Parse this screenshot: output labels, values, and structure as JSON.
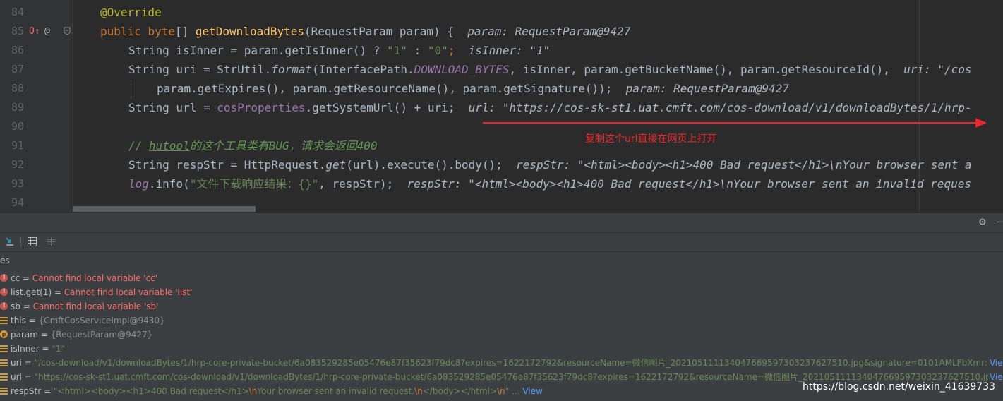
{
  "editor": {
    "line_numbers": [
      "84",
      "85",
      "86",
      "87",
      "88",
      "89",
      "90",
      "91",
      "92",
      "93",
      "94"
    ],
    "gutter_marks": {
      "override": "O↑",
      "at": "@"
    },
    "line84": {
      "annotation": "@Override"
    },
    "line85": {
      "kw_public": "public ",
      "kw_byte": "byte",
      "brackets": "[] ",
      "method": "getDownloadBytes",
      "params": "(RequestParam param) {",
      "hint": "param: RequestParam@9427"
    },
    "line86": {
      "decl": "String isInner = param.getIsInner() ? ",
      "s1": "\"1\"",
      "colon": " : ",
      "s2": "\"0\"",
      "semi": ";",
      "hint": "isInner: \"1\""
    },
    "line87": {
      "decl": "String uri = StrUtil.",
      "format": "format",
      "open": "(InterfacePath.",
      "const": "DOWNLOAD_BYTES",
      "rest": ", isInner, param.getBucketName(), param.getResourceId(),",
      "hint": "uri: \"/cos"
    },
    "line88": {
      "code": "param.getExpires(), param.getResourceName(), param.getSignature());",
      "hint": "param: RequestParam@9427"
    },
    "line89": {
      "decl": "String url = ",
      "field": "cosProperties",
      "rest": ".getSystemUrl() + uri;",
      "hint": "url: \"https://cos-sk-st1.uat.cmft.com/cos-download/v1/downloadBytes/1/hrp-"
    },
    "line91": {
      "slashes": "// ",
      "word": "hutool",
      "rest": "的这个工具类有BUG，请求会返回400"
    },
    "line92": {
      "decl": "String respStr = HttpRequest.",
      "get": "get",
      "rest": "(url).execute().body();",
      "hint": "respStr: \"<html><body><h1>400 Bad request</h1>\\nYour browser sent a"
    },
    "line93": {
      "log": "log",
      "info": ".info(",
      "s": "\"文件下载响应结果：{}\"",
      "rest": ", respStr);",
      "hint": "respStr: \"<html><body><h1>400 Bad request</h1>\\nYour browser sent an invalid reques"
    }
  },
  "annotation_text": "复制这个url直接在网页上打开",
  "panel": {
    "icons": {
      "gear": "gear-icon",
      "minimize": "minimize-icon",
      "table": "table-view-icon",
      "restore": "restore-layout-icon",
      "step": "step-into-icon"
    },
    "tab_label": "es",
    "variables": [
      {
        "icon": "error",
        "name": "cc",
        "eq": " = ",
        "value": "Cannot find local variable 'cc'"
      },
      {
        "icon": "error",
        "name": "list.get(1)",
        "eq": " = ",
        "value": "Cannot find local variable 'list'"
      },
      {
        "icon": "error",
        "name": "sb",
        "eq": " = ",
        "value": "Cannot find local variable 'sb'"
      },
      {
        "icon": "field",
        "name": "this",
        "eq": " = ",
        "value": "{CmftCosServiceImpl@9430}"
      },
      {
        "icon": "param",
        "name": "param",
        "eq": " = ",
        "value": "{RequestParam@9427}"
      },
      {
        "icon": "field",
        "name": "isInner",
        "eq": " = ",
        "value": "\"1\""
      },
      {
        "icon": "field",
        "name": "uri",
        "eq": " = ",
        "value": "\"/cos-download/v1/downloadBytes/1/hrp-core-private-bucket/6a083529285e05476e87f35623f79dc8?expires=1622172792&resourceName=微信图片_20210511113404766959730323762751­0.jpg&signature=0101AMLFbXmr:MDlFRTc...",
        "link": "Vie"
      },
      {
        "icon": "field",
        "name": "url",
        "eq": " = ",
        "value": "\"https://cos-sk-st1.uat.cmft.com/cos-download/v1/downloadBytes/1/hrp-core-private-bucket/6a083529285e05476e87f35623f79dc8?expires=1622172792&resourceName=微信图片_20210511113404766959730323762751­0.jpg&signa...",
        "link": "Vie"
      },
      {
        "icon": "field",
        "name": "respStr",
        "eq": " = ",
        "value_pre": "\"<html><body><h1>400 Bad request</h1>",
        "esc1": "\\n",
        "value_mid": "Your browser sent an invalid request.",
        "esc2": "\\n",
        "value_post": "</body></html>",
        "esc3": "\\n",
        "value_end": "\" ...",
        "view": "View"
      }
    ]
  },
  "watermark": "https://blog.csdn.net/weixin_41639733"
}
